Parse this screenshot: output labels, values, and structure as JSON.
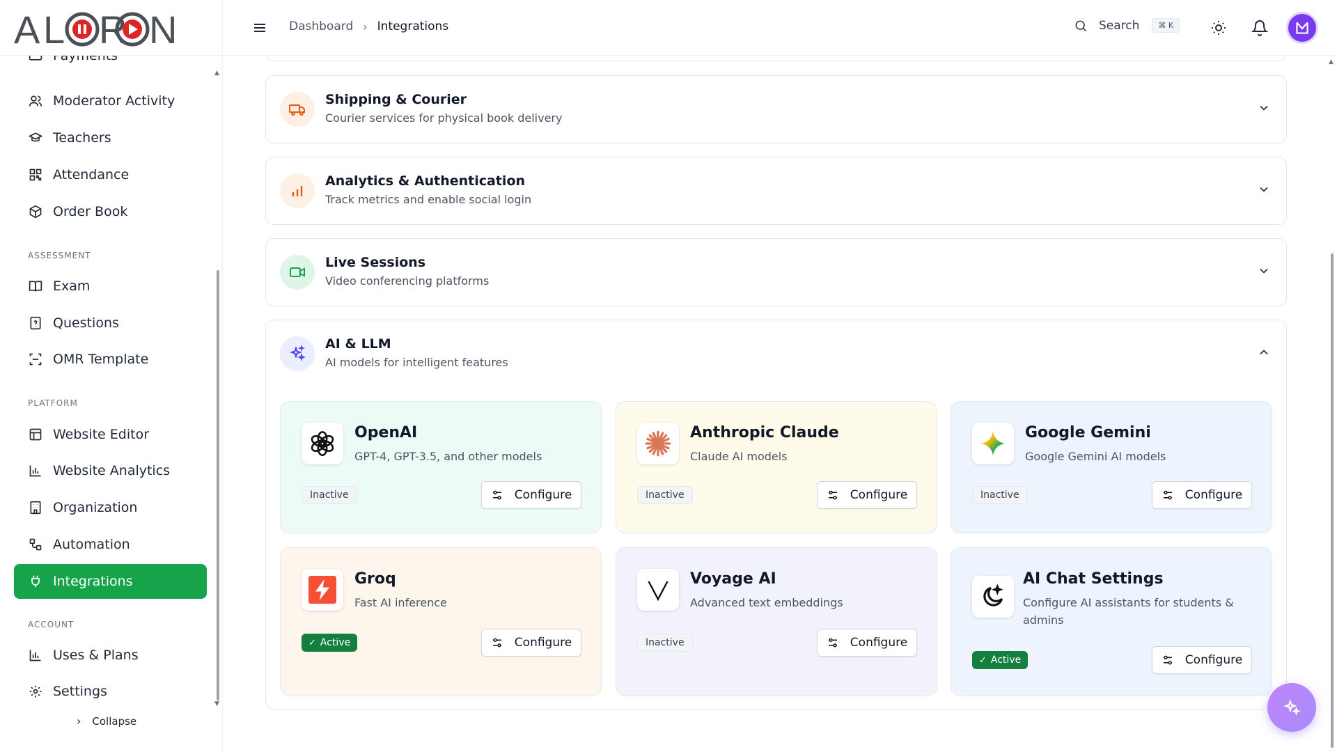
{
  "brand": {
    "logo_text": "ALORON"
  },
  "header": {
    "breadcrumb": {
      "root": "Dashboard",
      "current": "Integrations"
    },
    "search": {
      "label": "Search",
      "shortcut": "⌘ K"
    }
  },
  "sidebar": {
    "partial_item": "Payments",
    "items": [
      {
        "label": "Moderator Activity",
        "icon": "users-icon"
      },
      {
        "label": "Teachers",
        "icon": "graduation-cap-icon"
      },
      {
        "label": "Attendance",
        "icon": "qr-code-icon"
      },
      {
        "label": "Order Book",
        "icon": "package-icon"
      }
    ],
    "assessment_label": "ASSESSMENT",
    "assessment_items": [
      {
        "label": "Exam",
        "icon": "book-open-icon"
      },
      {
        "label": "Questions",
        "icon": "file-question-icon"
      },
      {
        "label": "OMR Template",
        "icon": "scan-icon"
      }
    ],
    "platform_label": "PLATFORM",
    "platform_items": [
      {
        "label": "Website Editor",
        "icon": "layout-icon"
      },
      {
        "label": "Website Analytics",
        "icon": "bar-chart-icon"
      },
      {
        "label": "Organization",
        "icon": "building-icon"
      },
      {
        "label": "Automation",
        "icon": "workflow-icon"
      },
      {
        "label": "Integrations",
        "icon": "plug-icon",
        "active": true
      }
    ],
    "account_label": "ACCOUNT",
    "account_items": [
      {
        "label": "Uses & Plans",
        "icon": "bar-chart-icon"
      },
      {
        "label": "Settings",
        "icon": "gear-icon"
      }
    ],
    "collapse_label": "Collapse"
  },
  "panels": [
    {
      "title": "Shipping & Courier",
      "subtitle": "Courier services for physical book delivery",
      "icon": "truck-icon",
      "expanded": false
    },
    {
      "title": "Analytics & Authentication",
      "subtitle": "Track metrics and enable social login",
      "icon": "chart-icon",
      "expanded": false
    },
    {
      "title": "Live Sessions",
      "subtitle": "Video conferencing platforms",
      "icon": "video-icon",
      "expanded": false
    },
    {
      "title": "AI & LLM",
      "subtitle": "AI models for intelligent features",
      "icon": "sparkles-icon",
      "expanded": true
    }
  ],
  "integrations": [
    {
      "name": "OpenAI",
      "description": "GPT-4, GPT-3.5, and other models",
      "status": "Inactive",
      "action": "Configure",
      "logo": "openai-logo-icon",
      "bg": "#ecfbf5"
    },
    {
      "name": "Anthropic Claude",
      "description": "Claude AI models",
      "status": "Inactive",
      "action": "Configure",
      "logo": "claude-logo-icon",
      "bg": "#fefbea"
    },
    {
      "name": "Google Gemini",
      "description": "Google Gemini AI models",
      "status": "Inactive",
      "action": "Configure",
      "logo": "gemini-logo-icon",
      "bg": "#eef4fd"
    },
    {
      "name": "Groq",
      "description": "Fast AI inference",
      "status": "Active",
      "action": "Configure",
      "logo": "groq-logo-icon",
      "bg": "#fef6ec"
    },
    {
      "name": "Voyage AI",
      "description": "Advanced text embeddings",
      "status": "Inactive",
      "action": "Configure",
      "logo": "voyage-logo-icon",
      "bg": "#f2f2fd"
    },
    {
      "name": "AI Chat Settings",
      "description": "Configure AI assistants for students & admins",
      "status": "Active",
      "action": "Configure",
      "logo": "ai-chat-logo-icon",
      "bg": "#eef4fd"
    }
  ],
  "colors": {
    "accent": "#16a34a",
    "active_badge": "#15803d",
    "avatar": "#7c3aed"
  }
}
